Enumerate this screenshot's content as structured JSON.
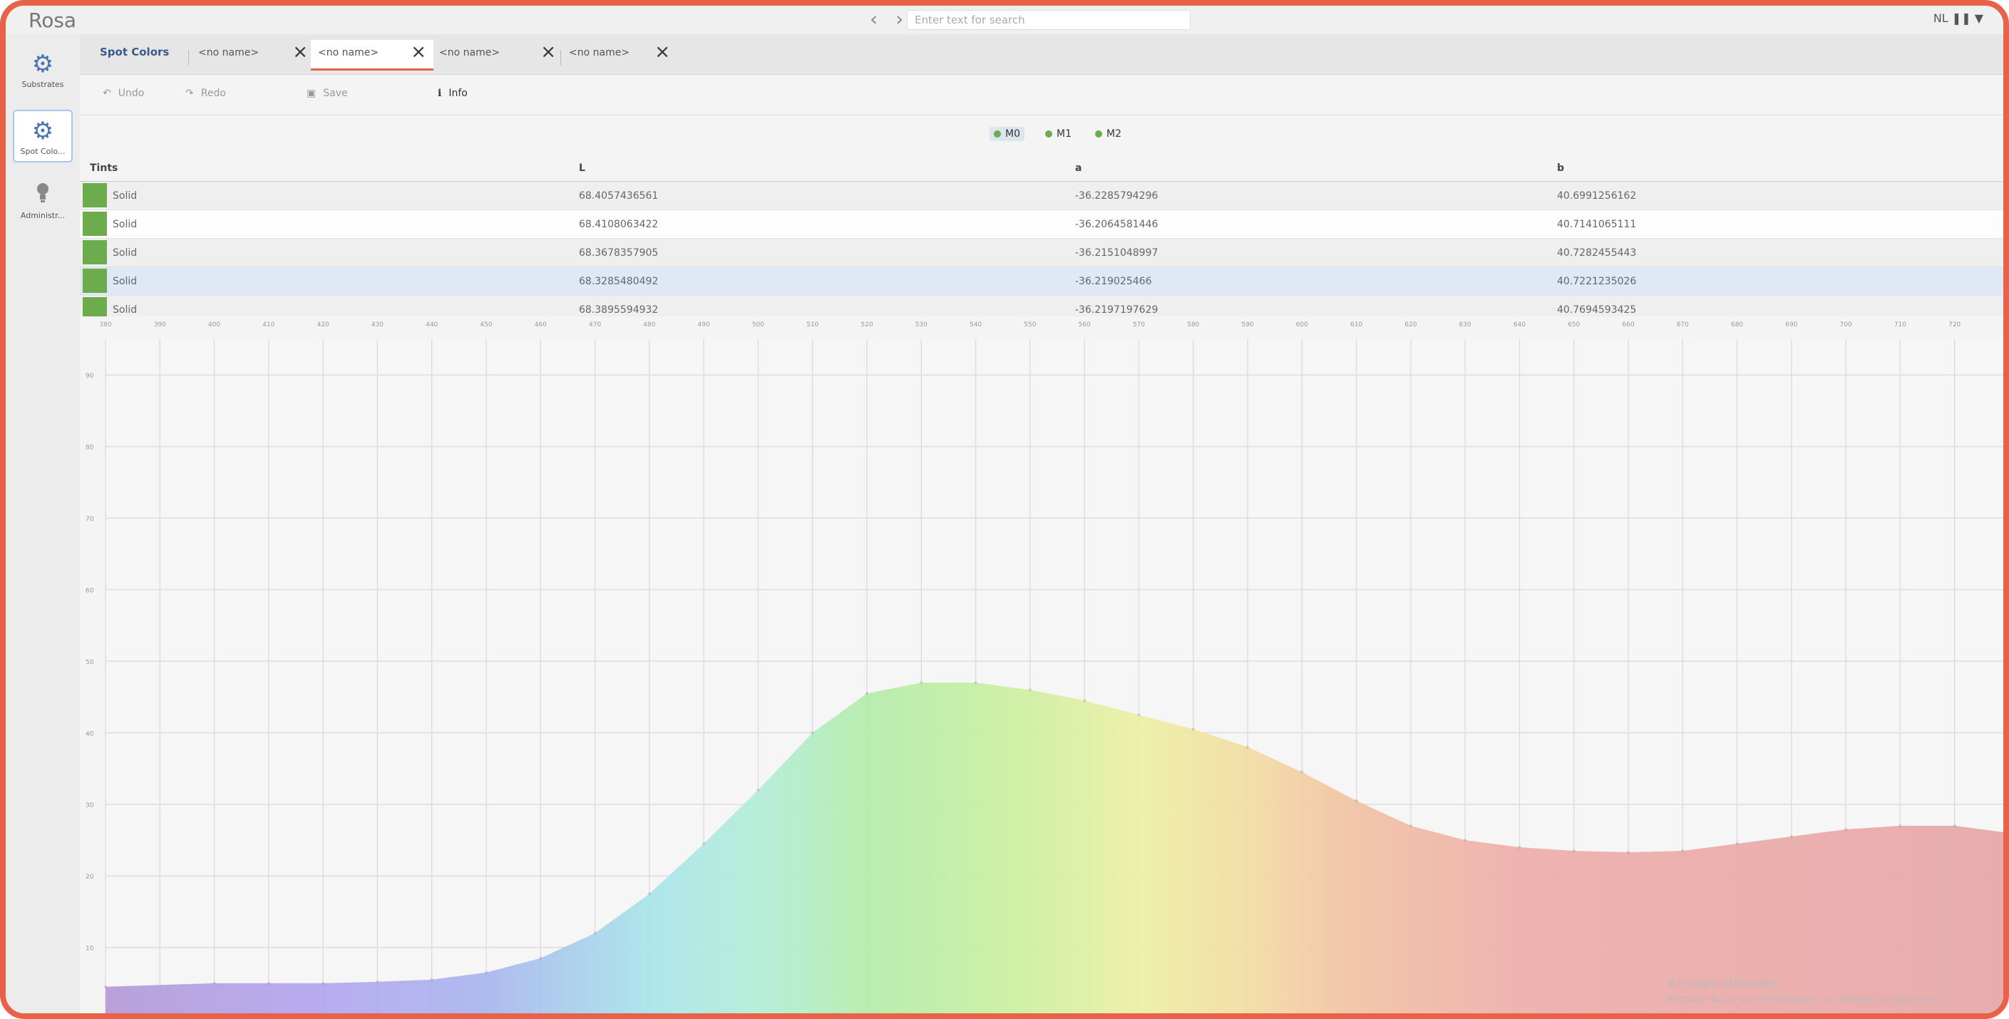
{
  "app": {
    "title": "Rosa"
  },
  "topbar": {
    "nav": "‹ ›",
    "search_placeholder": "Enter text for search",
    "right_text": "NL ❚❚ ▼"
  },
  "sidebar": {
    "items": [
      {
        "label": "Substrates",
        "icon": "gear-icon",
        "active": false
      },
      {
        "label": "Spot Colo...",
        "icon": "gear-icon",
        "active": true
      },
      {
        "label": "Administr...",
        "icon": "lightbulb-icon",
        "active": false
      }
    ]
  },
  "tabs": {
    "title": "Spot Colors",
    "items": [
      {
        "label": "<no name>",
        "active": false
      },
      {
        "label": "<no name>",
        "active": true
      },
      {
        "label": "<no name>",
        "active": false
      },
      {
        "label": "<no name>",
        "active": false
      }
    ]
  },
  "toolbar": {
    "undo": "Undo",
    "redo": "Redo",
    "save": "Save",
    "info": "Info"
  },
  "measurements": [
    "M0",
    "M1",
    "M2"
  ],
  "table": {
    "headers": [
      "Tints",
      "L",
      "a",
      "b"
    ],
    "rows": [
      {
        "tint": "Solid",
        "L": "68.4057436561",
        "a": "-36.2285794296",
        "b": "40.6991256162",
        "color": "#6dac4c"
      },
      {
        "tint": "Solid",
        "L": "68.4108063422",
        "a": "-36.2064581446",
        "b": "40.7141065111",
        "color": "#6dac4c"
      },
      {
        "tint": "Solid",
        "L": "68.3678357905",
        "a": "-36.2151048997",
        "b": "40.7282455443",
        "color": "#6dac4c"
      },
      {
        "tint": "Solid",
        "L": "68.3285480492",
        "a": "-36.219025466",
        "b": "40.7221235026",
        "color": "#6dac4c"
      },
      {
        "tint": "Solid",
        "L": "68.3895594932",
        "a": "-36.2197197629",
        "b": "40.7694593425",
        "color": "#6dac4c"
      }
    ]
  },
  "chart_data": {
    "type": "area",
    "title": "",
    "xlabel": "",
    "ylabel": "",
    "x": [
      380,
      400,
      410,
      420,
      430,
      440,
      450,
      460,
      470,
      480,
      490,
      500,
      510,
      520,
      530,
      540,
      550,
      560,
      570,
      580,
      590,
      600,
      610,
      620,
      630,
      640,
      650,
      660,
      670,
      680,
      690,
      700,
      710,
      720,
      730
    ],
    "series": [
      {
        "values": [
          4.5,
          5.0,
          5.0,
          5.0,
          5.2,
          5.5,
          6.5,
          8.5,
          12.0,
          17.5,
          24.5,
          32.0,
          40.0,
          45.5,
          47.0,
          47.0,
          46.0,
          44.5,
          42.5,
          40.5,
          38.0,
          34.5,
          30.5,
          27.0,
          25.0,
          24.0,
          23.5,
          23.3,
          23.5,
          24.5,
          25.5,
          26.5,
          27.0,
          27.0,
          26.0
        ]
      }
    ],
    "xlim": [
      380,
      730
    ],
    "ylim": [
      0,
      95
    ],
    "grid": true
  }
}
